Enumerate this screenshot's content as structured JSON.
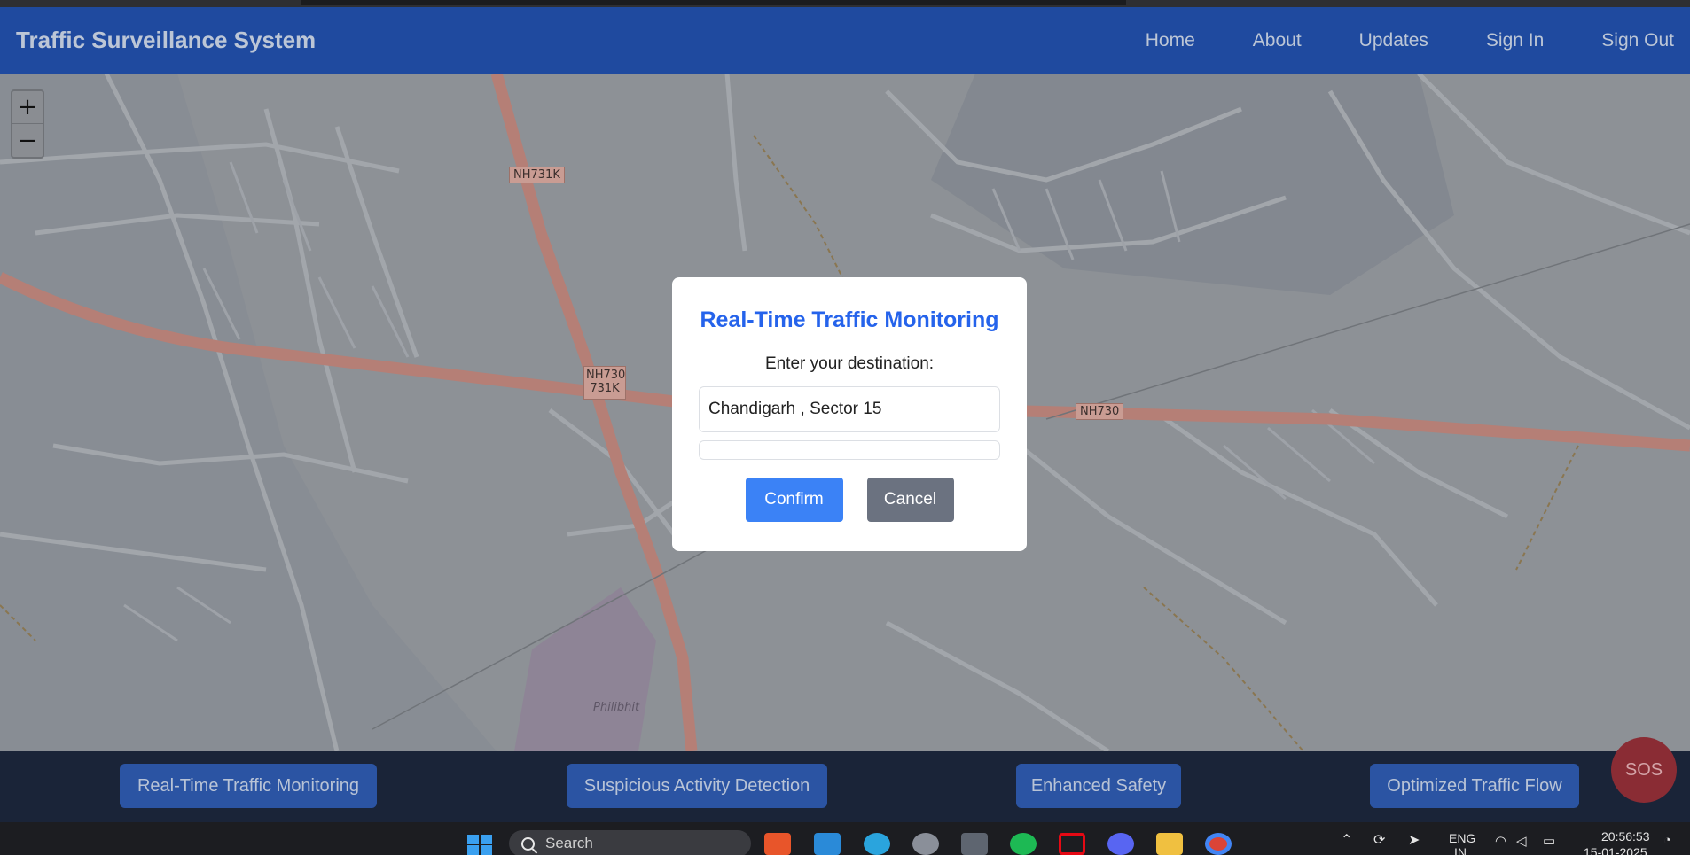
{
  "navbar": {
    "brand": "Traffic Surveillance System",
    "links": [
      "Home",
      "About",
      "Updates",
      "Sign In",
      "Sign Out"
    ]
  },
  "map": {
    "zoom_in": "+",
    "zoom_out": "−",
    "road_labels": [
      "NH731K",
      "NH730",
      "731K",
      "NH730"
    ],
    "place_label": "Philibhit"
  },
  "modal": {
    "title": "Real-Time Traffic Monitoring",
    "label": "Enter your destination:",
    "input_value": "Chandigarh , Sector 15",
    "confirm": "Confirm",
    "cancel": "Cancel"
  },
  "footer": {
    "features": [
      "Real-Time Traffic Monitoring",
      "Suspicious Activity Detection",
      "Enhanced Safety",
      "Optimized Traffic Flow"
    ],
    "sos": "SOS"
  },
  "taskbar": {
    "search_placeholder": "Search",
    "language": "ENG",
    "region": "IN",
    "time": "20:56:53",
    "date": "15-01-2025",
    "apps": [
      "windows-start-icon",
      "brave-icon",
      "vscode-icon",
      "telegram-icon",
      "settings-icon",
      "app-icon",
      "spotify-icon",
      "netflix-icon",
      "discord-icon",
      "file-explorer-icon",
      "chrome-icon"
    ]
  },
  "colors": {
    "navbar": "#1f4a9f",
    "modal_title": "#2563eb",
    "confirm": "#3b82f6",
    "cancel": "#6b7280",
    "footer": "#1a2438",
    "feature_button": "#2b54a3",
    "sos": "#8a2c34"
  }
}
